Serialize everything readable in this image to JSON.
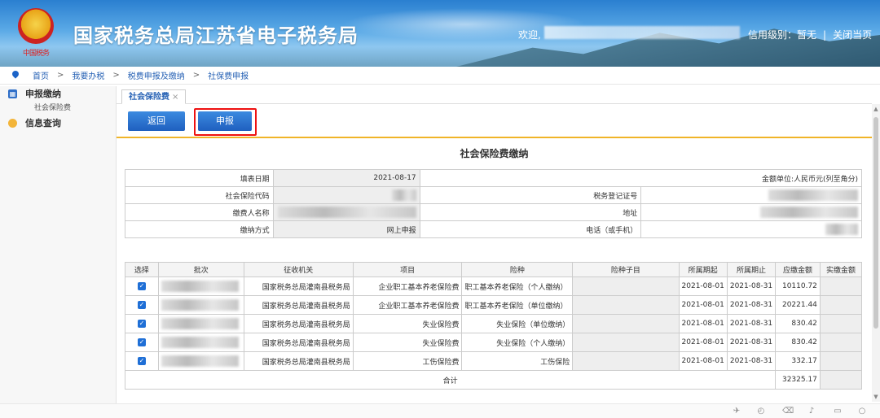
{
  "header": {
    "title": "国家税务总局江苏省电子税务局",
    "emblem_text": "中国税务",
    "welcome": "欢迎,",
    "credit_label": "信用级别：暂无",
    "separator": "|",
    "close_label": "关闭当页"
  },
  "breadcrumb": [
    "首页",
    "我要办税",
    "税费申报及缴纳",
    "社保费申报"
  ],
  "breadcrumb_sep": ">",
  "sidebar": {
    "sections": [
      {
        "label": "申报缴纳",
        "icon": "grid-icon",
        "items": [
          "社会保险费"
        ]
      },
      {
        "label": "信息查询",
        "icon": "chat-bubble-icon",
        "items": []
      }
    ]
  },
  "tab": {
    "label": "社会保险费",
    "close": "×"
  },
  "toolbar": {
    "back": "返回",
    "declare": "申报"
  },
  "form": {
    "title": "社会保险费缴纳",
    "fill_date_label": "填表日期",
    "fill_date": "2021-08-17",
    "amount_unit": "金额单位:人民币元(列至角分)",
    "ss_code_label": "社会保险代码",
    "tax_reg_label": "税务登记证号",
    "payer_name_label": "缴费人名称",
    "address_label": "地址",
    "pay_method_label": "缴纳方式",
    "pay_method": "网上申报",
    "phone_label": "电话（或手机）"
  },
  "table": {
    "headers": [
      "选择",
      "批次",
      "征收机关",
      "项目",
      "险种",
      "险种子目",
      "所属期起",
      "所属期止",
      "应缴金额",
      "实缴金额"
    ],
    "rows": [
      {
        "agency": "国家税务总局灌南县税务局",
        "item": "企业职工基本养老保险费",
        "type": "职工基本养老保险（个人缴纳）",
        "start": "2021-08-01",
        "end": "2021-08-31",
        "due": "10110.72"
      },
      {
        "agency": "国家税务总局灌南县税务局",
        "item": "企业职工基本养老保险费",
        "type": "职工基本养老保险（单位缴纳）",
        "start": "2021-08-01",
        "end": "2021-08-31",
        "due": "20221.44"
      },
      {
        "agency": "国家税务总局灌南县税务局",
        "item": "失业保险费",
        "type": "失业保险（单位缴纳）",
        "start": "2021-08-01",
        "end": "2021-08-31",
        "due": "830.42"
      },
      {
        "agency": "国家税务总局灌南县税务局",
        "item": "失业保险费",
        "type": "失业保险（个人缴纳）",
        "start": "2021-08-01",
        "end": "2021-08-31",
        "due": "830.42"
      },
      {
        "agency": "国家税务总局灌南县税务局",
        "item": "工伤保险费",
        "type": "工伤保险",
        "start": "2021-08-01",
        "end": "2021-08-31",
        "due": "332.17"
      }
    ],
    "total_label": "合计",
    "total": "32325.17",
    "check_mark": "✓"
  },
  "status_icons": [
    "pin-icon",
    "history-icon",
    "trash-icon",
    "speaker-icon",
    "window-icon",
    "search-icon"
  ],
  "status_glyphs": [
    "✈",
    "◴",
    "⌫",
    "♪",
    "▭",
    "○"
  ],
  "colors": {
    "brand_blue": "#2a7fd0",
    "button_blue": "#1f5fbf",
    "highlight_red": "#e11111",
    "accent_yellow": "#f0b428"
  }
}
